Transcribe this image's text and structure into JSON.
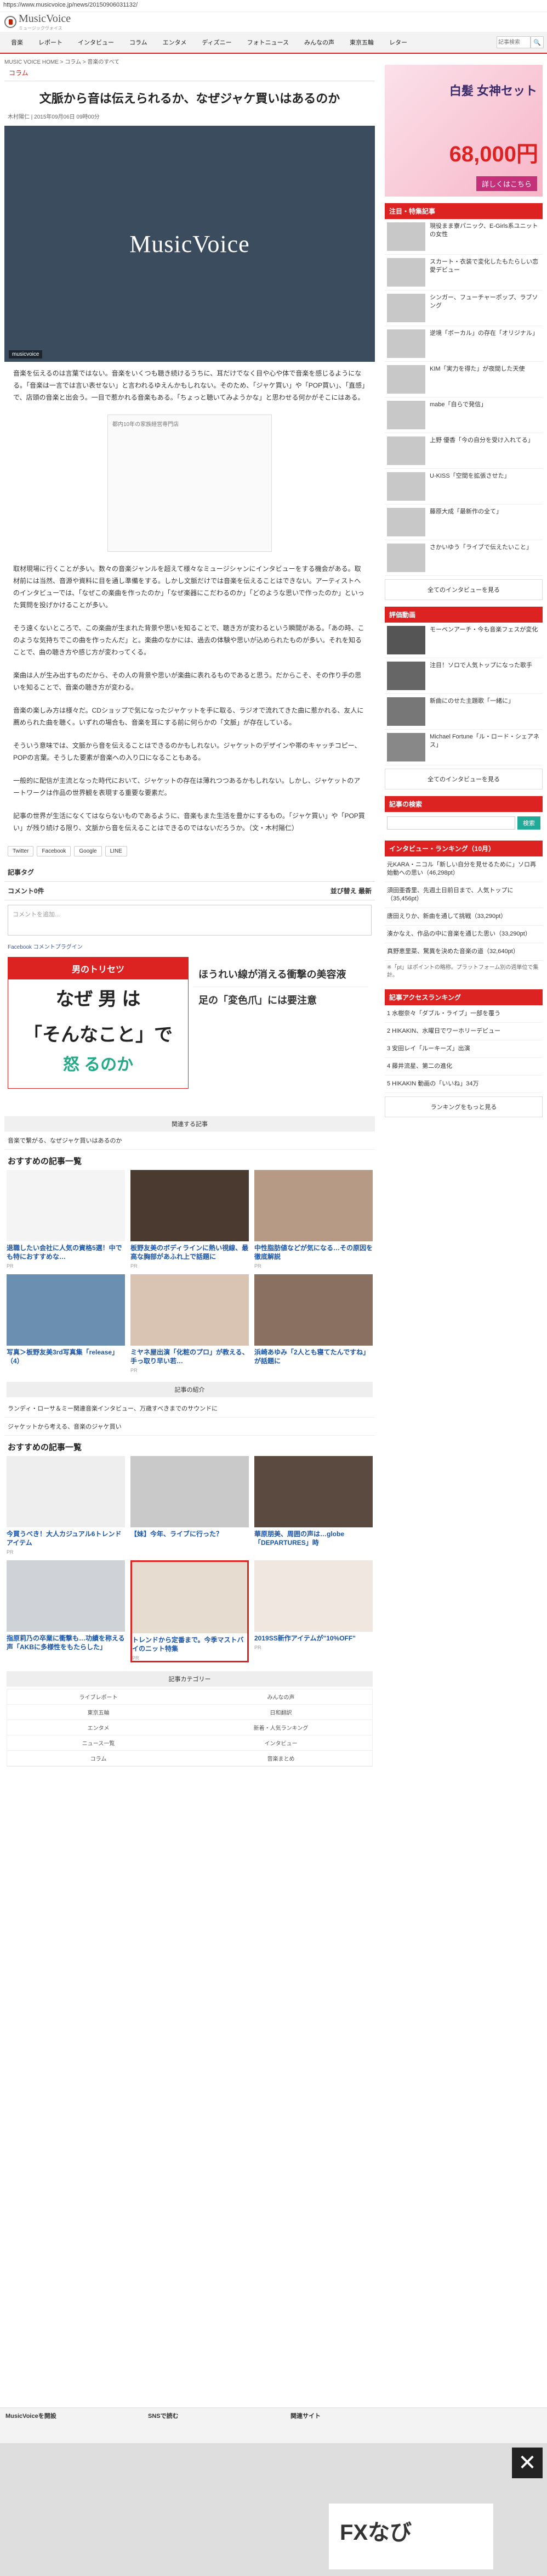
{
  "url": "https://www.musicvoice.jp/news/20150906031132/",
  "logo": {
    "text": "MusicVoice",
    "sub": "ミュージックヴォイス"
  },
  "nav": [
    "音楽",
    "レポート",
    "インタビュー",
    "コラム",
    "エンタメ",
    "ディズニー",
    "フォトニュース",
    "みんなの声",
    "東京五輪",
    "レター"
  ],
  "search_placeholder": "記事検索",
  "breadcrumb": "MUSIC VOICE HOME > コラム > 音楽のすべて",
  "article": {
    "category": "コラム",
    "title": "文脈から音は伝えられるか、なぜジャケ買いはあるのか",
    "meta": "木村陽仁 | 2015年09月06日 09時00分",
    "hero_logo": "MusicVoice",
    "hero_caption": "musicvoice",
    "p1": "音楽を伝えるのは言葉ではない。音楽をいくつも聴き続けるうちに、耳だけでなく目や心や体で音楽を感じるようになる。「音楽は一言では言い表せない」と言われるゆえんかもしれない。そのため、「ジャケ買い」や「POP買い」、「直感」で、店頭の音楽と出会う。一目で惹かれる音楽もある。「ちょっと聴いてみようかな」と思わせる何かがそこにはある。",
    "ad1": "都内10年の家族経営専門店",
    "p2": "取材現場に行くことが多い。数々の音楽ジャンルを超えて様々なミュージシャンにインタビューをする機会がある。取材前には当然、音源や資料に目を通し準備をする。しかし文脈だけでは音楽を伝えることはできない。アーティストへのインタビューでは、「なぜこの楽曲を作ったのか」「なぜ楽器にこだわるのか」「どのような思いで作ったのか」といった質問を投げかけることが多い。",
    "p3": "そう遠くないところで、この楽曲が生まれた背景や思いを知ることで、聴き方が変わるという瞬間がある。「あの時、このような気持ちでこの曲を作ったんだ」と。楽曲のなかには、過去の体験や思いが込められたものが多い。それを知ることで、曲の聴き方や感じ方が変わってくる。",
    "p4": "楽曲は人が生み出すものだから、その人の背景や思いが楽曲に表れるものであると思う。だからこそ、その作り手の思いを知ることで、音楽の聴き方が変わる。",
    "p5": "音楽の楽しみ方は様々だ。CDショップで気になったジャケットを手に取る、ラジオで流れてきた曲に惹かれる、友人に薦められた曲を聴く。いずれの場合も、音楽を耳にする前に何らかの「文脈」が存在している。",
    "p6": "そういう意味では、文脈から音を伝えることはできるのかもしれない。ジャケットのデザインや帯のキャッチコピー、POPの言葉。そうした要素が音楽への入り口になることもある。",
    "p7": "一般的に配信が主流となった時代において、ジャケットの存在は薄れつつあるかもしれない。しかし、ジャケットのアートワークは作品の世界観を表現する重要な要素だ。",
    "p8": "記事の世界が生活になくてはならないものであるように、音楽もまた生活を豊かにするもの。「ジャケ買い」や「POP買い」が残り続ける限り、文脈から音を伝えることはできるのではないだろうか。（文・木村陽仁）"
  },
  "share": [
    "Twitter",
    "Facebook",
    "Google",
    "LINE"
  ],
  "tags_label": "記事タグ",
  "comments": {
    "title": "コメント0件",
    "sort_label": "並び替え",
    "sort_value": "最新",
    "placeholder": "コメントを追加...",
    "fb_label": "Facebook コメントプラグイン"
  },
  "ad_red": {
    "top": "男のトリセツ",
    "q1": "なぜ 男 は",
    "q2": "「そんなこと」で",
    "q3": "怒 るのか"
  },
  "ad_right": [
    "ほうれい線が消える衝撃の美容液",
    "足の「変色爪」には要注意"
  ],
  "related": {
    "title": "関連する記事",
    "items": [
      "音楽で繋がる、なぜジャケ買いはあるのか"
    ]
  },
  "recommend_title": "おすすめの記事一覧",
  "recommend1": [
    {
      "title": "退職したい会社に人気の資格5選！中でも特におすすめな…",
      "src": "PR"
    },
    {
      "title": "板野友美のボディラインに熱い視線、最高な胸部があふれ上で話題に",
      "src": "PR"
    },
    {
      "title": "中性脂肪値などが気になる…その原因を徹底解説",
      "src": "PR"
    },
    {
      "title": "写真＞板野友美3rd写真集「release」（4）",
      "src": ""
    },
    {
      "title": "ミヤネ屋出演「化粧のプロ」が教える、手っ取り早い若…",
      "src": "PR"
    },
    {
      "title": "浜崎あゆみ「2人とも寝てたんですね」が話題に",
      "src": ""
    }
  ],
  "recommend2_header": "記事の紹介",
  "recommend2_items": [
    "ランディ・ローサ＆ミー関連音楽インタビュー、万歳すべきまでのサウンドに",
    "ジャケットから考える、音楽のジャケ買い"
  ],
  "recommend3": [
    {
      "title": "今買うべき！大人カジュアル6トレンドアイテム",
      "src": "PR"
    },
    {
      "title": "【妹】今年、ライブに行った？",
      "src": ""
    },
    {
      "title": "華原朋美、周囲の声は…globe「DEPARTURES」時",
      "src": ""
    },
    {
      "title": "指原莉乃の卒業に衝撃も…功績を称える声「AKBに多様性をもたらした」",
      "src": ""
    },
    {
      "title": "トレンドから定番まで。今季マストバイのニット特集",
      "src": "PR"
    },
    {
      "title": "2019SS新作アイテムが\"10%OFF\"",
      "src": "PR"
    }
  ],
  "category_header": "記事カテゴリー",
  "categories": [
    "ライブレポート",
    "みんなの声",
    "東京五輪",
    "日和翻訳",
    "エンタメ",
    "新着・人気ランキング",
    "ニュース一覧",
    "インタビュー",
    "コラム",
    "音楽まとめ"
  ],
  "side": {
    "banner_title": "白髪 女神セット",
    "banner_price": "68,000円",
    "banner_cta": "詳しくはこちら",
    "sec1": "注目・特集記事",
    "sec1_items": [
      "現役まま寮パニック、E-Girls系ユニットの女性",
      "スカート・衣装で変化したもたらしい恋愛デビュー",
      "シンガー、フューチャーポップ、ラブソング",
      "逆境「ボーカル」の存在「オリジナル」",
      "KIM「実力を得た」が夜間した天使",
      "mabe「自らで発信」",
      "上野 優香「今の自分を受け入れてる」",
      "U-KISS「空間を拡張させた」",
      "藤原大成「最新作の全て」",
      "さかいゆう「ライブで伝えたいこと」"
    ],
    "sec1_more": "全てのインタビューを見る",
    "sec2": "評価動画",
    "sec2_items": [
      "モーベンアーチ・今も音楽フェスが変化",
      "注目！ソロで人気トップになった歌手",
      "新曲にのせた主題歌「一緒に」",
      "Michael Fortune「ル・ロード・シェアネス」"
    ],
    "sec2_more": "全てのインタビューを見る",
    "search_h": "記事の検索",
    "search_btn": "検索",
    "sec3": "インタビュー・ランキング（10月）",
    "sec3_items": [
      "元KARA・ニコル「新しい自分を見せるために」ソロ再始動への思い（46,298pt）",
      "須田亜香里、先週土日前日まで、人気トップに（35,456pt）",
      "唐田えりか、新曲を通して挑戦（33,290pt）",
      "湊かなえ、作品の中に音楽を通じた思い（33,290pt）",
      "真野恵里菜、驚異を決めた音楽の道（32,640pt）"
    ],
    "note": "※「pt」はポイントの略称。プラットフォーム別の週単位で集計。",
    "sec4": "記事アクセスランキング",
    "sec4_items": [
      "1 水樹奈々「ダブル・ライブ」一部を覆う",
      "2 HIKAKIN、水曜日でワーホリーデビュー",
      "3 安田レイ「ルーキーズ」出演",
      "4 藤井流星、第二の進化",
      "5 HIKAKIN 動画の「いいね」34万"
    ],
    "sec4_more": "ランキングをもっと見る"
  },
  "footer": {
    "col1": "MusicVoiceを開設",
    "col2": "SNSで読む",
    "col3": "関連サイト"
  },
  "bottom_ad": {
    "close": "✕",
    "text": "FXなび"
  }
}
